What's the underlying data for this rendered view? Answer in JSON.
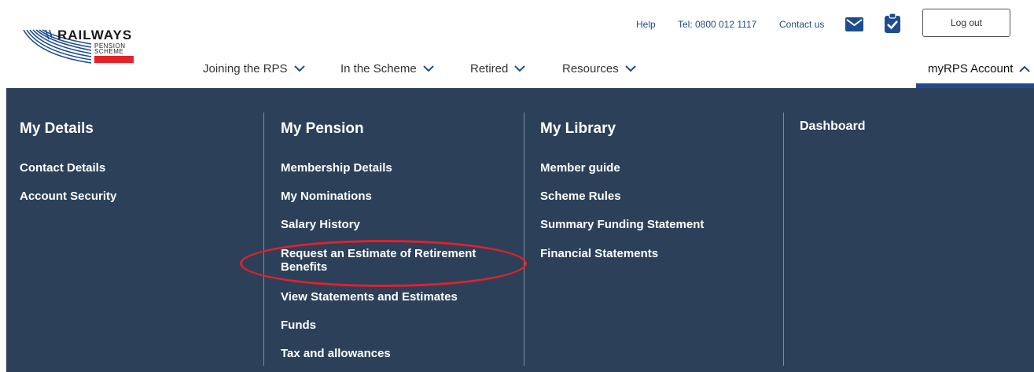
{
  "logo": {
    "word": "RAILWAYS",
    "sub1": "PENSION",
    "sub2": "SCHEME"
  },
  "utility": {
    "help": "Help",
    "tel": "Tel: 0800 012 1117",
    "contact": "Contact us",
    "logout": "Log out"
  },
  "nav": {
    "joining": "Joining the RPS",
    "scheme": "In the Scheme",
    "retired": "Retired",
    "resources": "Resources",
    "account": "myRPS Account"
  },
  "menu": {
    "my_details": {
      "title": "My Details",
      "links": [
        "Contact Details",
        "Account Security"
      ]
    },
    "my_pension": {
      "title": "My Pension",
      "links": [
        "Membership Details",
        "My Nominations",
        "Salary History",
        "Request an Estimate of Retirement",
        "Benefits",
        "View Statements and Estimates",
        "Funds",
        "Tax and allowances"
      ]
    },
    "my_library": {
      "title": "My Library",
      "links": [
        "Member guide",
        "Scheme Rules",
        "Summary Funding Statement",
        "Financial Statements"
      ]
    },
    "dashboard": {
      "title": "Dashboard"
    }
  },
  "colors": {
    "brand_blue": "#1e4c8f",
    "menu_bg": "#2c4159",
    "highlight": "#e4202a"
  }
}
